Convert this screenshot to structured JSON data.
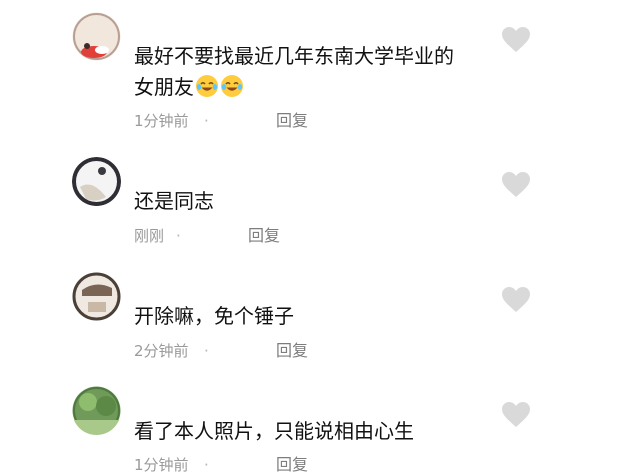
{
  "comments": [
    {
      "text_lines": [
        "最好不要找最近几年东南大学毕业的",
        "女朋友"
      ],
      "emoji": [
        "crying-laughing-face",
        "crying-laughing-face"
      ],
      "time": "1分钟前",
      "reply_label": "回复",
      "liked": false
    },
    {
      "text_lines": [
        "还是同志"
      ],
      "time": "刚刚",
      "reply_label": "回复",
      "liked": false
    },
    {
      "text_lines": [
        "开除嘛，免个锤子"
      ],
      "time": "2分钟前",
      "reply_label": "回复",
      "liked": false
    },
    {
      "text_lines": [
        "看了本人照片，只能说相由心生"
      ],
      "time": "1分钟前",
      "reply_label": "回复",
      "liked": false
    }
  ],
  "colors": {
    "text": "#111111",
    "meta": "#9a9a9a",
    "like_icon": "#d9d9d9"
  }
}
